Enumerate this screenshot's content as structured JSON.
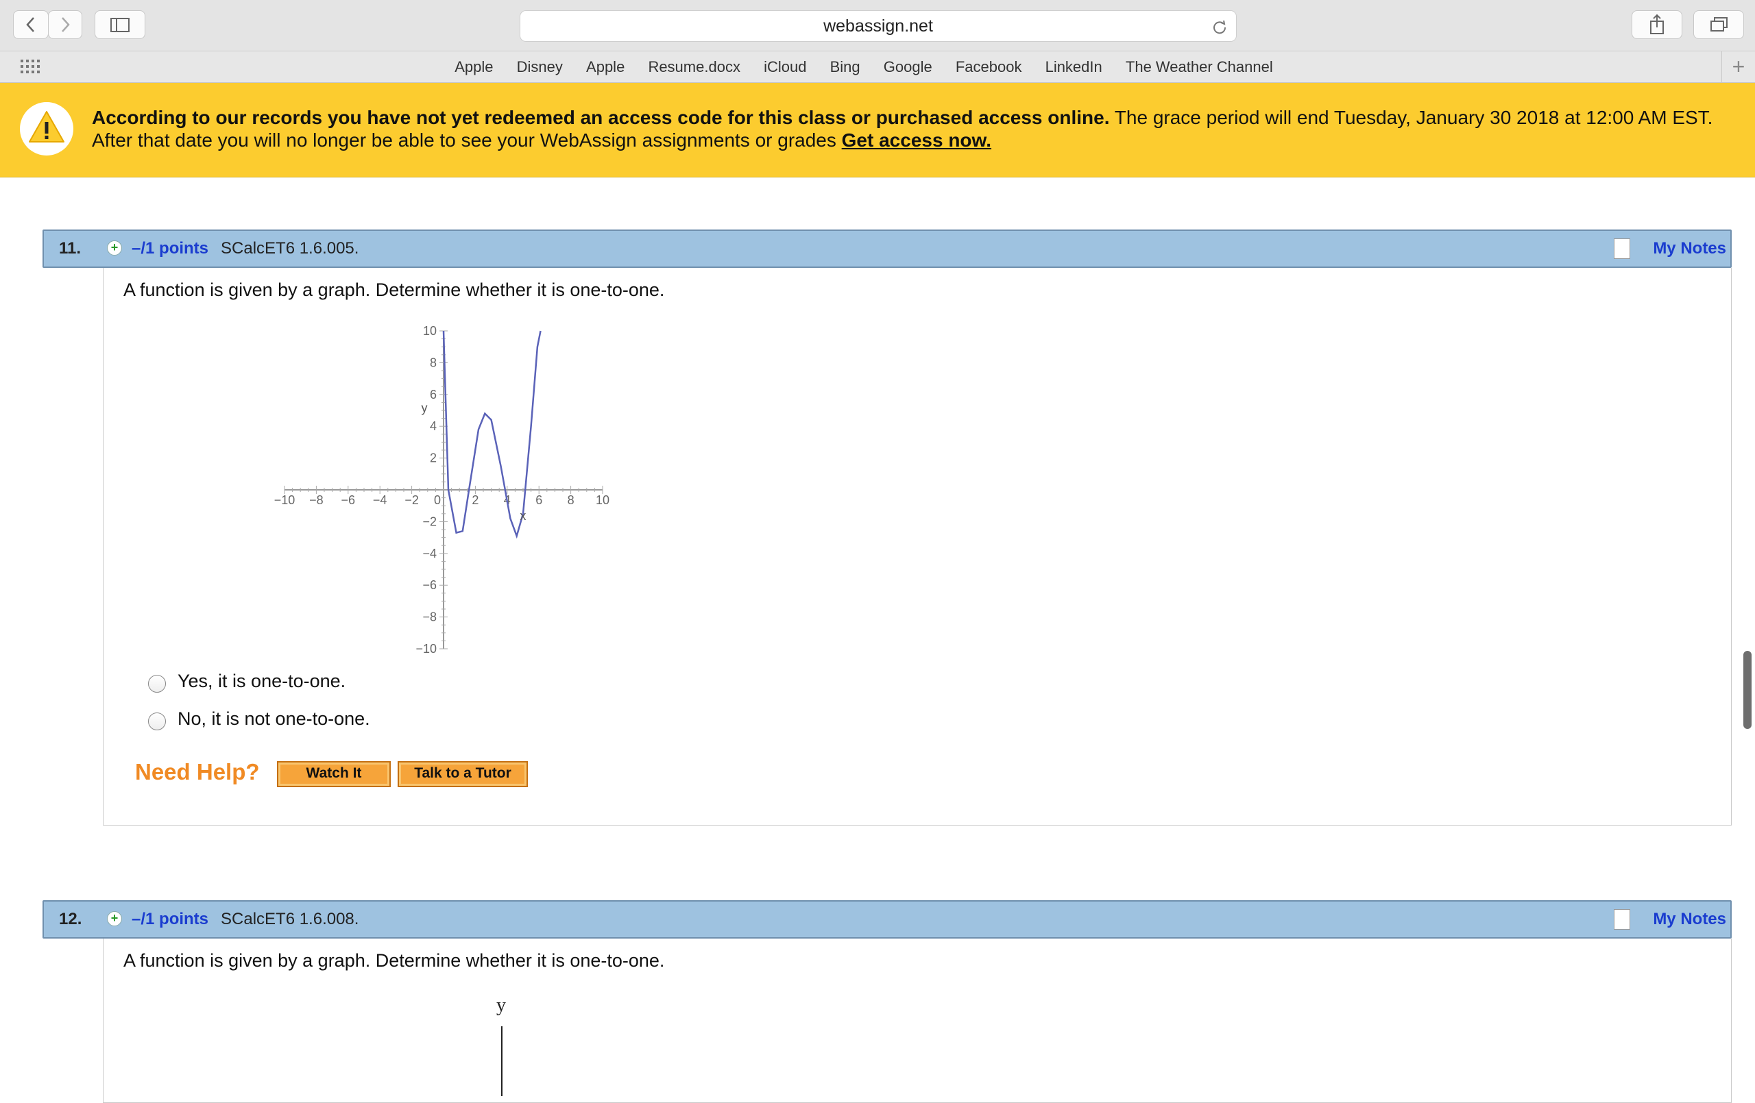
{
  "browser": {
    "url": "webassign.net",
    "bookmarks": [
      "Apple",
      "Disney",
      "Apple",
      "Resume.docx",
      "iCloud",
      "Bing",
      "Google",
      "Facebook",
      "LinkedIn",
      "The Weather Channel"
    ]
  },
  "banner": {
    "bold_text": "According to our records you have not yet redeemed an access code for this class or purchased access online.",
    "text1": " The grace period will end Tuesday, January 30 2018 at 12:00 AM EST.",
    "text2": "After that date you will no longer be able to see your WebAssign assignments or grades ",
    "link": "Get access now."
  },
  "questions": [
    {
      "number": "11.",
      "points": "–/1 points",
      "code": "SCalcET6 1.6.005.",
      "notes": "My Notes",
      "prompt": "A function is given by a graph. Determine whether it is one-to-one.",
      "choices": [
        "Yes, it is one-to-one.",
        "No, it is not one-to-one."
      ],
      "help": {
        "label": "Need Help?",
        "watch": "Watch It",
        "tutor": "Talk to a Tutor"
      }
    },
    {
      "number": "12.",
      "points": "–/1 points",
      "code": "SCalcET6 1.6.008.",
      "notes": "My Notes",
      "prompt": "A function is given by a graph. Determine whether it is one-to-one.",
      "graph_ylabel": "y"
    }
  ],
  "chart_data": {
    "type": "line",
    "xlim": [
      -10,
      10
    ],
    "ylim": [
      -10,
      10
    ],
    "xlabel": "x",
    "ylabel": "y",
    "x_ticks": [
      "−10",
      "−8",
      "−6",
      "−4",
      "−2",
      "0",
      "2",
      "4",
      "6",
      "8",
      "10"
    ],
    "y_ticks_pos": [
      "10",
      "8",
      "6",
      "4",
      "2"
    ],
    "y_ticks_neg": [
      "−2",
      "−4",
      "−6",
      "−8",
      "−10"
    ],
    "x": [
      0,
      0.3,
      0.8,
      1.2,
      1.6,
      2.2,
      2.6,
      3.0,
      3.6,
      4.2,
      4.6,
      5.0,
      5.5,
      5.9,
      6.1
    ],
    "y": [
      10,
      0,
      -2.7,
      -2.6,
      0,
      3.8,
      4.8,
      4.4,
      1.5,
      -1.8,
      -2.9,
      -1.5,
      4,
      9,
      10
    ],
    "color": "#5a62b8"
  }
}
